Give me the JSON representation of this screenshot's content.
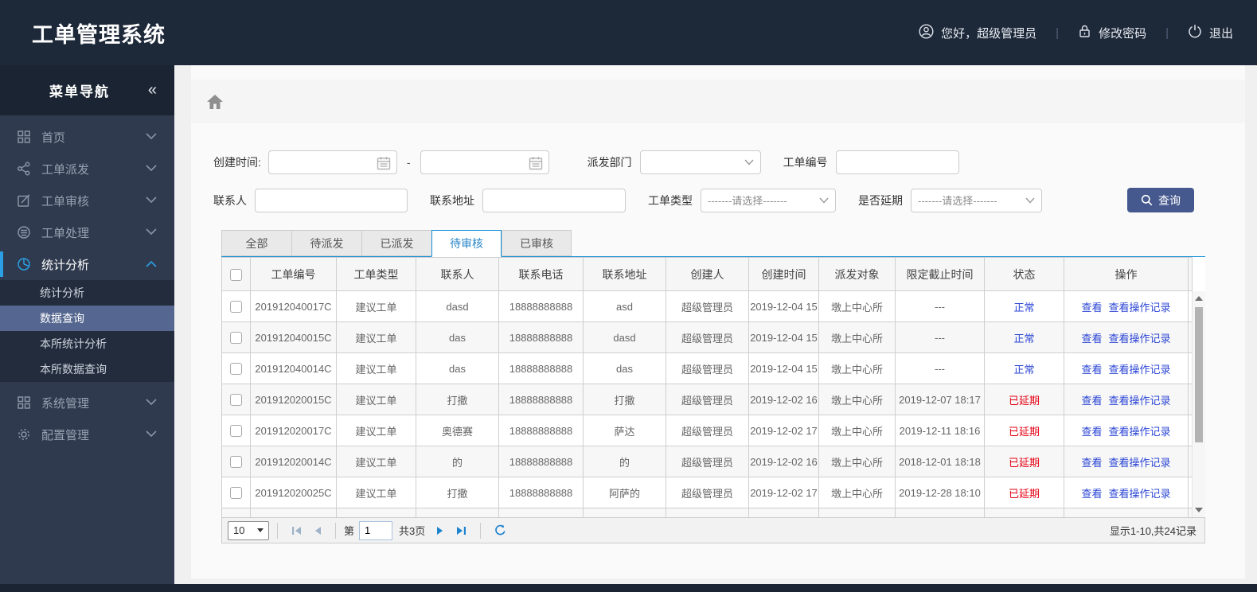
{
  "app": {
    "title": "工单管理系统"
  },
  "header": {
    "greeting": "您好，超级管理员",
    "change_password": "修改密码",
    "logout": "退出",
    "separator": "|"
  },
  "sidebar": {
    "title": "菜单导航",
    "collapse_glyph": "«",
    "items": [
      {
        "label": "首页",
        "icon": "grid-icon"
      },
      {
        "label": "工单派发",
        "icon": "share-icon"
      },
      {
        "label": "工单审核",
        "icon": "edit-icon"
      },
      {
        "label": "工单处理",
        "icon": "database-icon"
      },
      {
        "label": "统计分析",
        "icon": "pie-chart-icon",
        "active": true,
        "expanded": true
      },
      {
        "label": "系统管理",
        "icon": "modules-icon"
      },
      {
        "label": "配置管理",
        "icon": "gear-icon"
      }
    ],
    "submenu": [
      {
        "label": "统计分析"
      },
      {
        "label": "数据查询",
        "active": true
      },
      {
        "label": "本所统计分析"
      },
      {
        "label": "本所数据查询"
      }
    ]
  },
  "filters": {
    "created_time_label": "创建时间:",
    "range_separator": "-",
    "date_from_value": "",
    "date_to_value": "",
    "dispatch_dept_label": "派发部门",
    "dispatch_dept_value": "",
    "order_no_label": "工单编号",
    "order_no_value": "",
    "contact_label": "联系人",
    "contact_value": "",
    "contact_address_label": "联系地址",
    "contact_address_value": "",
    "order_type_label": "工单类型",
    "order_type_value": "-------请选择-------",
    "is_delayed_label": "是否延期",
    "is_delayed_value": "-------请选择-------",
    "search_button": "查询"
  },
  "tabs": [
    {
      "label": "全部"
    },
    {
      "label": "待派发"
    },
    {
      "label": "已派发"
    },
    {
      "label": "待审核",
      "active": true
    },
    {
      "label": "已审核"
    }
  ],
  "table": {
    "columns": [
      "工单编号",
      "工单类型",
      "联系人",
      "联系电话",
      "联系地址",
      "创建人",
      "创建时间",
      "派发对象",
      "限定截止时间",
      "状态",
      "操作"
    ],
    "action_labels": [
      "查看",
      "查看操作记录"
    ],
    "rows": [
      {
        "order_no": "201912040017C",
        "order_type": "建议工单",
        "contact": "dasd",
        "phone": "18888888888",
        "address": "asd",
        "creator": "超级管理员",
        "created": "2019-12-04 15",
        "target": "墩上中心所",
        "deadline": "---",
        "status": "正常",
        "status_color": "blue"
      },
      {
        "order_no": "201912040015C",
        "order_type": "建议工单",
        "contact": "das",
        "phone": "18888888888",
        "address": "dasd",
        "creator": "超级管理员",
        "created": "2019-12-04 15",
        "target": "墩上中心所",
        "deadline": "---",
        "status": "正常",
        "status_color": "blue"
      },
      {
        "order_no": "201912040014C",
        "order_type": "建议工单",
        "contact": "das",
        "phone": "18888888888",
        "address": "das",
        "creator": "超级管理员",
        "created": "2019-12-04 15",
        "target": "墩上中心所",
        "deadline": "---",
        "status": "正常",
        "status_color": "blue"
      },
      {
        "order_no": "201912020015C",
        "order_type": "建议工单",
        "contact": "打撒",
        "phone": "18888888888",
        "address": "打撒",
        "creator": "超级管理员",
        "created": "2019-12-02 16",
        "target": "墩上中心所",
        "deadline": "2019-12-07 18:17",
        "status": "已延期",
        "status_color": "red"
      },
      {
        "order_no": "201912020017C",
        "order_type": "建议工单",
        "contact": "奥德赛",
        "phone": "18888888888",
        "address": "萨达",
        "creator": "超级管理员",
        "created": "2019-12-02 17",
        "target": "墩上中心所",
        "deadline": "2019-12-11 18:16",
        "status": "已延期",
        "status_color": "red"
      },
      {
        "order_no": "201912020014C",
        "order_type": "建议工单",
        "contact": "的",
        "phone": "18888888888",
        "address": "的",
        "creator": "超级管理员",
        "created": "2019-12-02 16",
        "target": "墩上中心所",
        "deadline": "2018-12-01 18:18",
        "status": "已延期",
        "status_color": "red"
      },
      {
        "order_no": "201912020025C",
        "order_type": "建议工单",
        "contact": "打撒",
        "phone": "18888888888",
        "address": "阿萨的",
        "creator": "超级管理员",
        "created": "2019-12-02 17",
        "target": "墩上中心所",
        "deadline": "2019-12-28 18:10",
        "status": "已延期",
        "status_color": "red"
      }
    ]
  },
  "pagination": {
    "page_size": "10",
    "page_prefix": "第",
    "current_page": "1",
    "total_pages": "共3页",
    "summary": "显示1-10,共24记录"
  },
  "colors": {
    "header_bg": "#1d2839",
    "sidebar_bg": "#2f3a4e",
    "submenu_active_bg": "#556790",
    "accent_blue": "#2b9fe3",
    "tab_active_blue": "#2786c8",
    "tab_underline": "#1790d6",
    "link_blue": "#2b45d5",
    "status_red": "#e60012",
    "search_button_bg": "#46598e"
  }
}
